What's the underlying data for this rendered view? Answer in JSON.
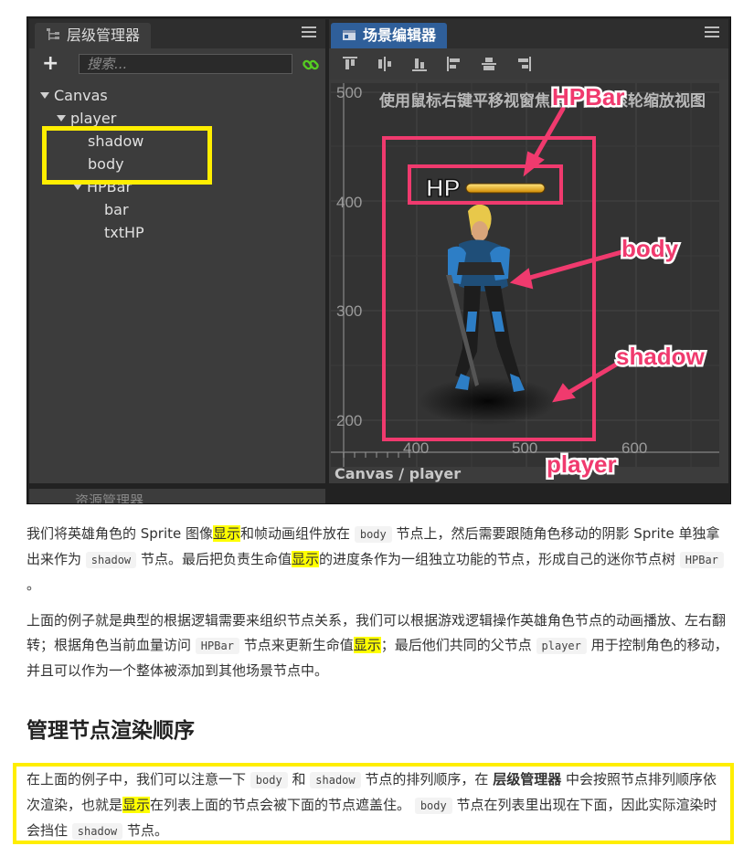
{
  "hierarchy": {
    "tab_label": "层级管理器",
    "search_placeholder": "搜索...",
    "nodes": [
      "Canvas",
      "player",
      "shadow",
      "body",
      "HPBar",
      "bar",
      "txtHP"
    ]
  },
  "assets": {
    "tab_label": "资源管理器"
  },
  "scene": {
    "tab_label": "场景编辑器",
    "hint": "使用鼠标右键平移视窗焦点，使用滚轮缩放视图",
    "y_labels": [
      "500",
      "400",
      "300",
      "200"
    ],
    "x_labels": [
      "400",
      "500",
      "600"
    ],
    "hp_text": "HP",
    "status": "Canvas / player",
    "annotations": {
      "hpbar": "HPBar",
      "body": "body",
      "shadow": "shadow",
      "player": "player"
    }
  },
  "article": {
    "p1": {
      "a": "我们将英雄角色的 Sprite 图像",
      "h1": "显示",
      "b": "和帧动画组件放在",
      "c1": "body",
      "c": "节点上，然后需要跟随角色移动的阴影 Sprite 单独拿出来作为",
      "c2": "shadow",
      "d": "节点。最后把负责生命值",
      "h2": "显示",
      "e": "的进度条作为一组独立功能的节点，形成自己的迷你节点树",
      "c3": "HPBar",
      "f": "。"
    },
    "p2": {
      "a": "上面的例子就是典型的根据逻辑需要来组织节点关系，我们可以根据游戏逻辑操作英雄角色节点的动画播放、左右翻转；根据角色当前血量访问",
      "c1": "HPBar",
      "b": "节点来更新生命值",
      "h1": "显示",
      "c": "；最后他们共同的父节点",
      "c2": "player",
      "d": "用于控制角色的移动，并且可以作为一个整体被添加到其他场景节点中。"
    },
    "heading": "管理节点渲染顺序",
    "p3": {
      "a": "在上面的例子中，我们可以注意一下",
      "c1": "body",
      "b": "和",
      "c2": "shadow",
      "c": "节点的排列顺序，在",
      "strong": "层级管理器",
      "d": "中会按照节点排列顺序依次渲染，也就是",
      "h1": "显示",
      "e": "在列表上面的节点会被下面的节点遮盖住。",
      "c3": "body",
      "f": "节点在列表里出现在下面，因此实际渲染时会挡住",
      "c4": "shadow",
      "g": "节点。"
    }
  }
}
